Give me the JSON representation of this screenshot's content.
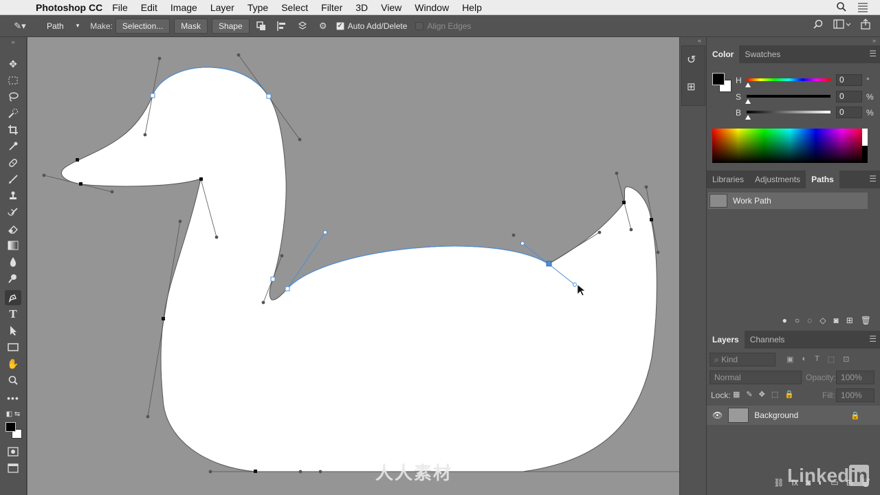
{
  "menubar": {
    "app_name": "Photoshop CC",
    "items": [
      "File",
      "Edit",
      "Image",
      "Layer",
      "Type",
      "Select",
      "Filter",
      "3D",
      "View",
      "Window",
      "Help"
    ]
  },
  "options_bar": {
    "tool_mode": "Path",
    "make_label": "Make:",
    "selection_button": "Selection...",
    "mask_button": "Mask",
    "shape_button": "Shape",
    "auto_add_delete_label": "Auto Add/Delete",
    "auto_add_delete_checked": true,
    "align_edges_label": "Align Edges",
    "align_edges_checked": false
  },
  "color_panel": {
    "tabs": [
      "Color",
      "Swatches"
    ],
    "active_tab": "Color",
    "h_label": "H",
    "h_value": "0",
    "h_unit": "°",
    "s_label": "S",
    "s_value": "0",
    "s_unit": "%",
    "b_label": "B",
    "b_value": "0",
    "b_unit": "%",
    "foreground": "#000000",
    "background": "#ffffff"
  },
  "paths_panel": {
    "tabs": [
      "Libraries",
      "Adjustments",
      "Paths"
    ],
    "active_tab": "Paths",
    "paths": [
      {
        "name": "Work Path"
      }
    ]
  },
  "layers_panel": {
    "tabs": [
      "Layers",
      "Channels"
    ],
    "active_tab": "Layers",
    "filter_placeholder": "Kind",
    "blend_mode": "Normal",
    "opacity_label": "Opacity:",
    "opacity_value": "100%",
    "lock_label": "Lock:",
    "fill_label": "Fill:",
    "fill_value": "100%",
    "layers": [
      {
        "name": "Background",
        "locked": true,
        "visible": true
      }
    ]
  },
  "watermark": "人人素材",
  "branding": {
    "linkedin_text": "Linked",
    "linkedin_box": "in"
  }
}
